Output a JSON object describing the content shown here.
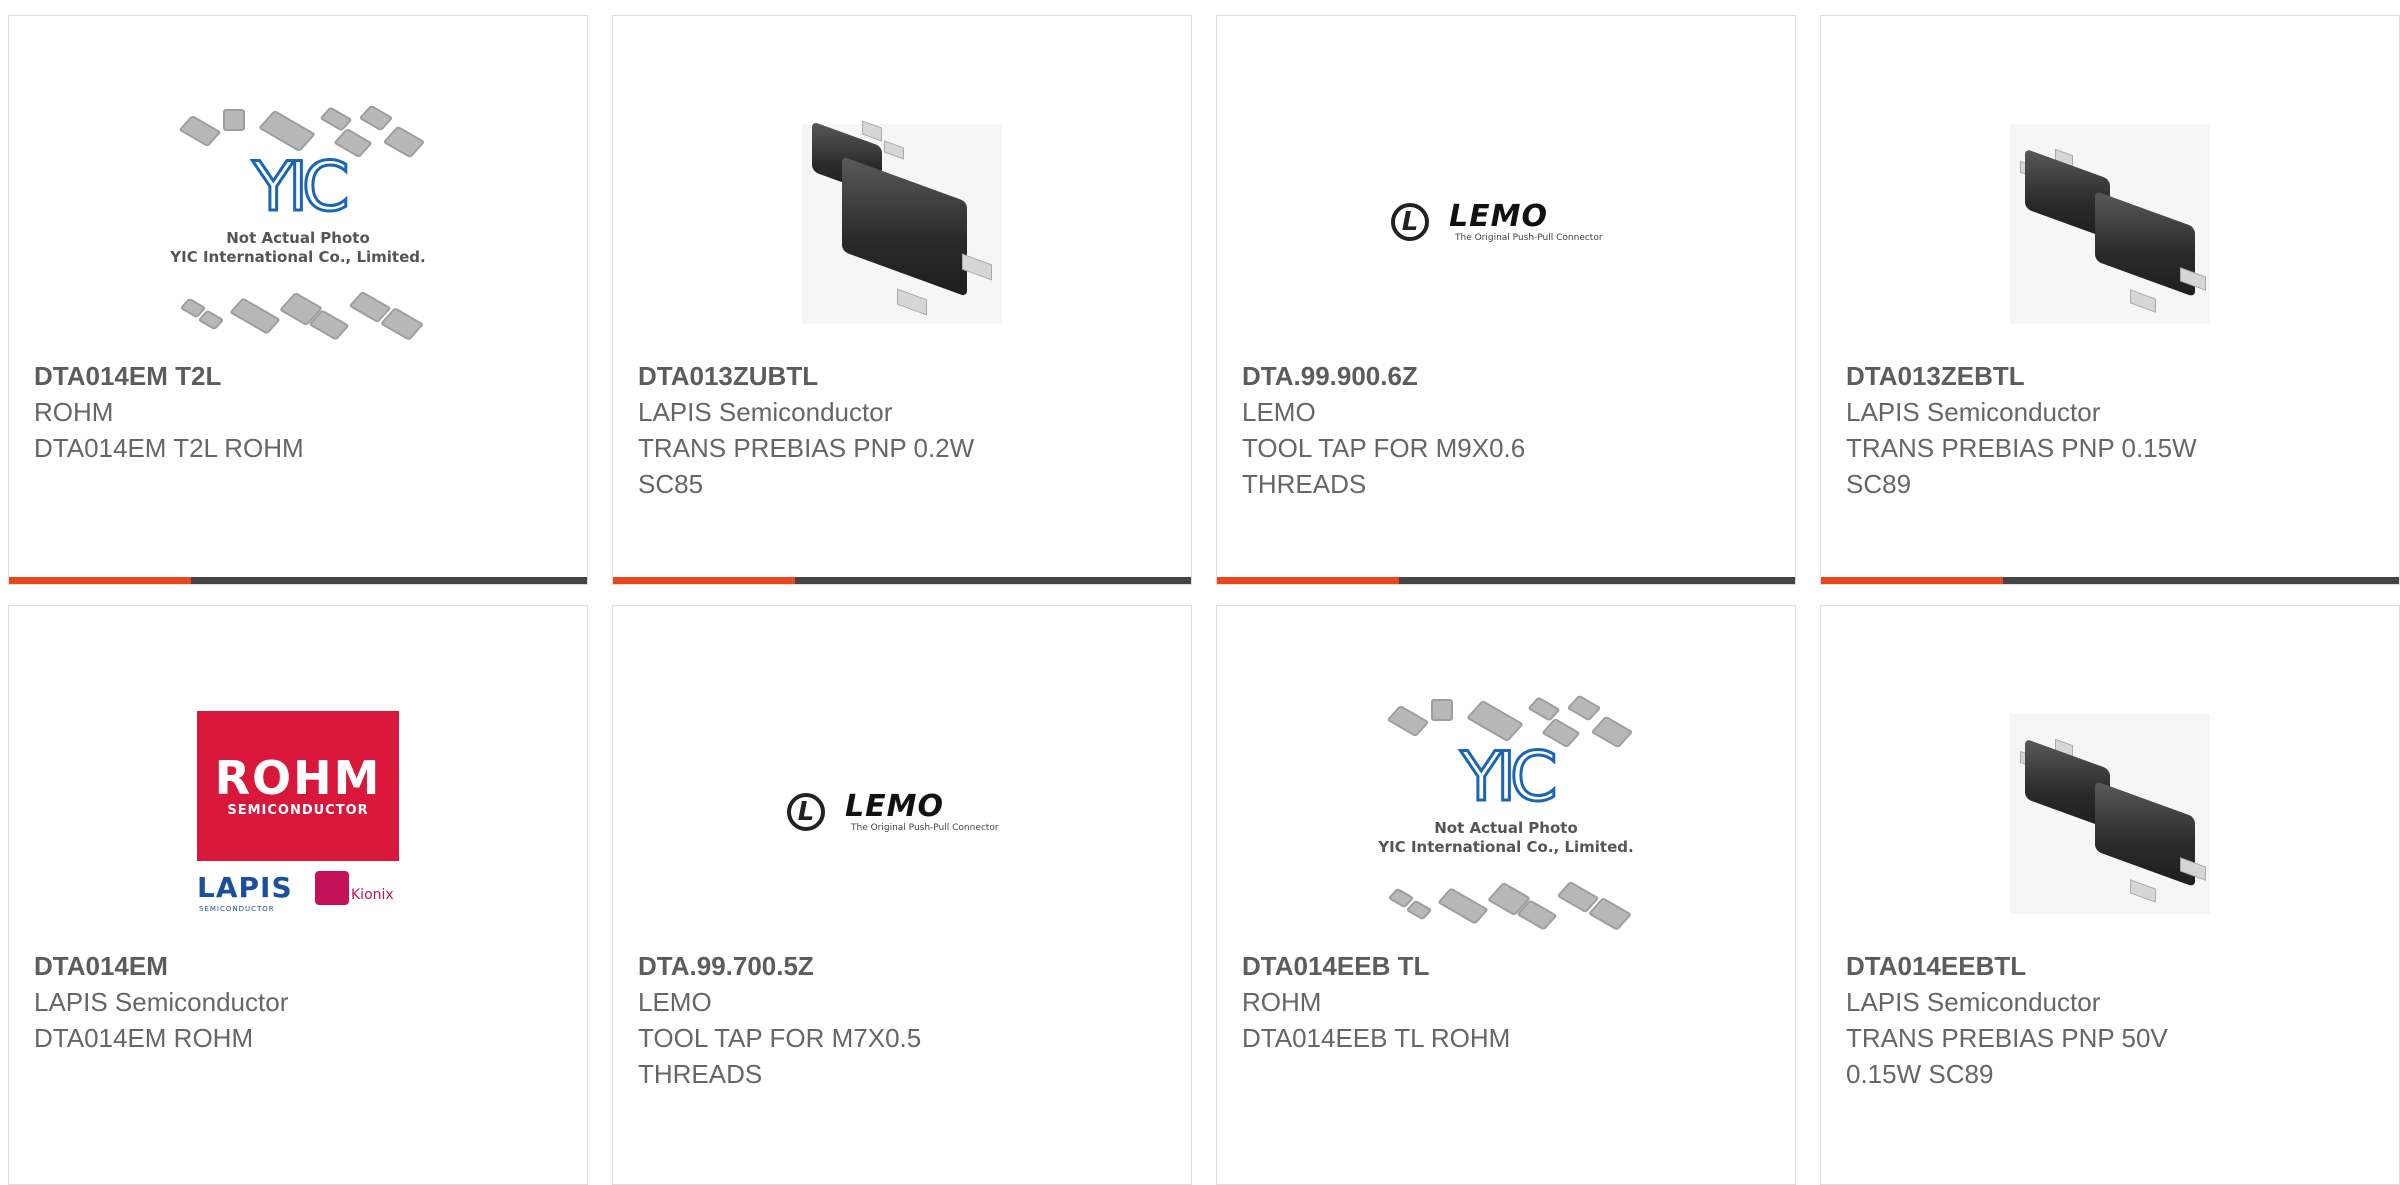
{
  "colors": {
    "accent": "#e8461c",
    "bar": "#444444",
    "text": "#666666"
  },
  "image_text": {
    "placeholder_line1": "Not Actual Photo",
    "placeholder_line2": "YIC International Co., Limited.",
    "placeholder_logo": "YIC",
    "lemo_word": "LEMO",
    "lemo_tagline": "The Original Push-Pull Connector",
    "rohm_word": "ROHM",
    "rohm_sub": "SEMICONDUCTOR",
    "lapis_word": "LAPIS",
    "lapis_sub": "SEMICONDUCTOR",
    "kionix_word": "Kionix"
  },
  "products": [
    {
      "part": "DTA014EM T2L",
      "maker": "ROHM",
      "description": "DTA014EM T2L ROHM",
      "image": "yic-placeholder"
    },
    {
      "part": "DTA013ZUBTL",
      "maker": "LAPIS Semiconductor",
      "description": "TRANS PREBIAS PNP 0.2W SC85",
      "image": "smd-package"
    },
    {
      "part": "DTA.99.900.6Z",
      "maker": "LEMO",
      "description": "TOOL TAP FOR M9X0.6 THREADS",
      "image": "lemo-logo"
    },
    {
      "part": "DTA013ZEBTL",
      "maker": "LAPIS Semiconductor",
      "description": "TRANS PREBIAS PNP 0.15W SC89",
      "image": "smd-package"
    },
    {
      "part": "DTA014EM",
      "maker": "LAPIS Semiconductor",
      "description": "DTA014EM ROHM",
      "image": "rohm-lapis-logo"
    },
    {
      "part": "DTA.99.700.5Z",
      "maker": "LEMO",
      "description": "TOOL TAP FOR M7X0.5 THREADS",
      "image": "lemo-logo"
    },
    {
      "part": "DTA014EEB TL",
      "maker": "ROHM",
      "description": "DTA014EEB TL ROHM",
      "image": "yic-placeholder"
    },
    {
      "part": "DTA014EEBTL",
      "maker": "LAPIS Semiconductor",
      "description": "TRANS PREBIAS PNP 50V 0.15W SC89",
      "image": "smd-package"
    }
  ]
}
